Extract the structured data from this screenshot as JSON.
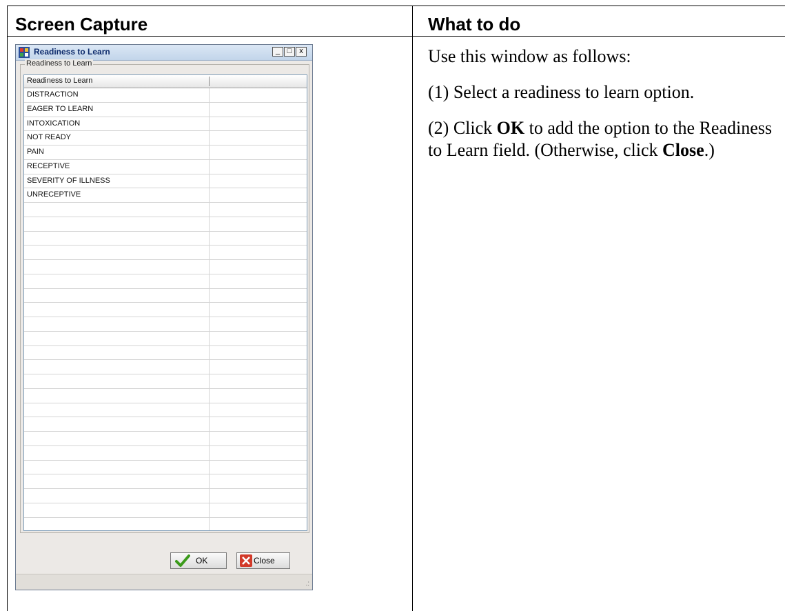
{
  "table": {
    "col1_header": "Screen Capture",
    "col2_header": "What to do"
  },
  "window": {
    "title": "Readiness to Learn",
    "group_label": "Readiness to Learn",
    "column_header": "Readiness to Learn",
    "items": [
      "DISTRACTION",
      "EAGER TO LEARN",
      "INTOXICATION",
      "NOT READY",
      "PAIN",
      "RECEPTIVE",
      "SEVERITY OF ILLNESS",
      "UNRECEPTIVE"
    ],
    "ok_label": "OK",
    "close_label": "Close",
    "min_glyph": "_",
    "max_glyph": "□",
    "close_glyph": "x"
  },
  "instructions": {
    "intro": "Use this window as follows:",
    "step1": "(1) Select a readiness to learn option.",
    "step2_pre": "(2) Click ",
    "step2_ok": "OK",
    "step2_mid": " to add the option to the Readiness to Learn field. (Otherwise, click ",
    "step2_close": "Close",
    "step2_post": ".)"
  },
  "colors": {
    "ok_check": "#3a9a1a",
    "close_x": "#d23a2a",
    "title_text": "#0c2a6b"
  }
}
